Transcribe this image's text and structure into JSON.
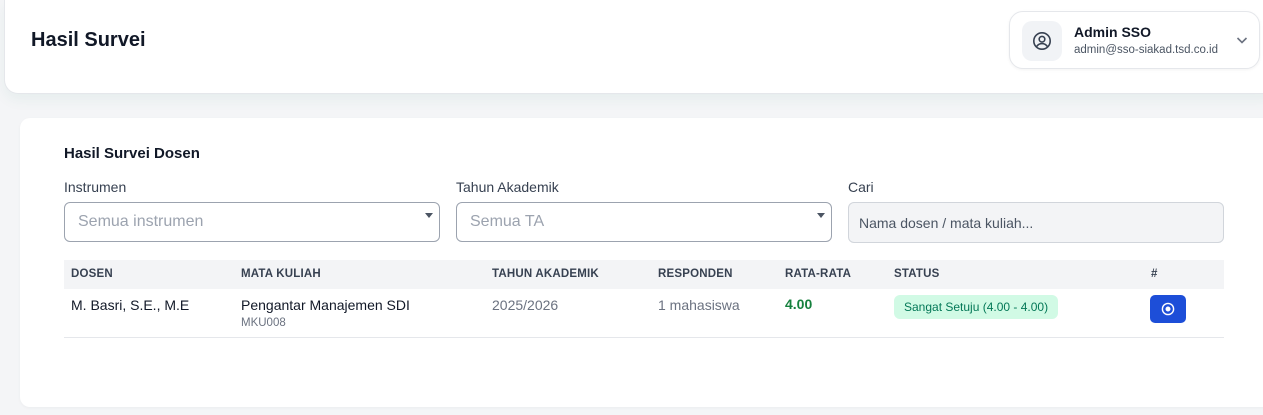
{
  "header": {
    "title": "Hasil Survei",
    "user": {
      "name": "Admin SSO",
      "email": "admin@sso-siakad.tsd.co.id",
      "avatar_icon": "user-circle-icon",
      "menu_icon": "chevron-down-icon"
    }
  },
  "card": {
    "title": "Hasil Survei Dosen",
    "filters": {
      "instrument": {
        "label": "Instrumen",
        "value": "Semua instrumen"
      },
      "academic_year": {
        "label": "Tahun Akademik",
        "value": "Semua TA"
      },
      "search": {
        "label": "Cari",
        "placeholder": "Nama dosen / mata kuliah..."
      }
    },
    "table": {
      "columns": [
        "DOSEN",
        "MATA KULIAH",
        "TAHUN AKADEMIK",
        "RESPONDEN",
        "RATA-RATA",
        "STATUS",
        "#"
      ],
      "rows": [
        {
          "lecturer": "M. Basri, S.E., M.E",
          "course": "Pengantar Manajemen SDI",
          "course_code": "MKU008",
          "academic_year": "2025/2026",
          "respondents": "1 mahasiswa",
          "average": "4.00",
          "status": "Sangat Setuju (4.00 - 4.00)",
          "action_icon": "view-detail-icon"
        }
      ]
    }
  },
  "colors": {
    "accent": "#1d4ed8",
    "average_text": "#15803d",
    "status_badge_bg": "#d1fae5",
    "status_badge_text": "#047857"
  }
}
